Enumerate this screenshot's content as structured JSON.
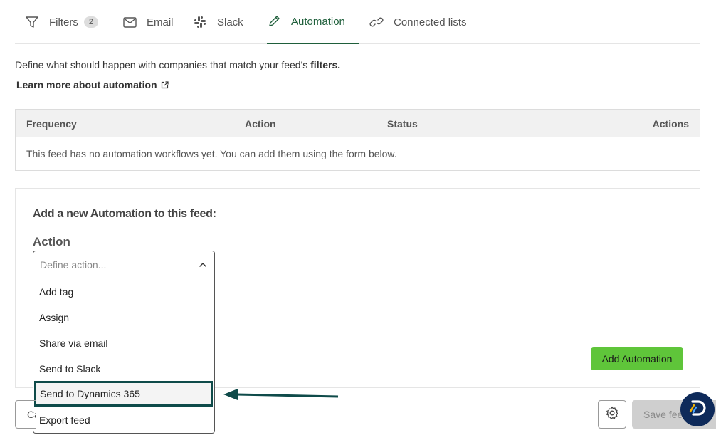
{
  "tabs": [
    {
      "label": "Filters",
      "badge": "2",
      "icon": "filter-icon"
    },
    {
      "label": "Email",
      "icon": "envelope-icon"
    },
    {
      "label": "Slack",
      "icon": "slack-icon"
    },
    {
      "label": "Automation",
      "icon": "pencil-icon",
      "active": true
    },
    {
      "label": "Connected lists",
      "icon": "link-icon"
    }
  ],
  "intro": {
    "text": "Define what should happen with companies that match your feed's",
    "bold": "filters."
  },
  "learn_more": {
    "label": "Learn more about automation",
    "icon": "external-link-icon"
  },
  "table": {
    "headers": {
      "frequency": "Frequency",
      "action": "Action",
      "status": "Status",
      "actions": "Actions"
    },
    "empty_message": "This feed has no automation workflows yet. You can add them using the form below."
  },
  "panel": {
    "title": "Add a new Automation to this feed:",
    "action_label": "Action",
    "select_placeholder": "Define action...",
    "options": [
      "Add tag",
      "Assign",
      "Share via email",
      "Send to Slack",
      "Send to Dynamics 365",
      "Export feed"
    ],
    "highlighted_option": "Send to Dynamics 365",
    "add_button": "Add Automation"
  },
  "footer": {
    "cancel_label": "Cancel",
    "save_label": "Save feed"
  },
  "colors": {
    "active_tab": "#1f5f3b",
    "add_button": "#5fc53a",
    "highlight_border": "#0f4b4a",
    "fab": "#0e2a5a"
  }
}
